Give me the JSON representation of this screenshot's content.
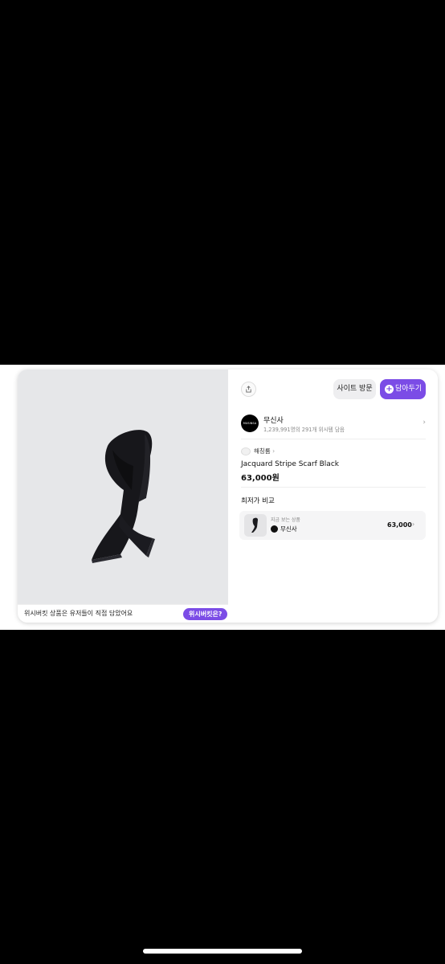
{
  "photo_footer": {
    "text": "위시버킷 상품은 유저들이 직접 담았어요",
    "pill_label": "위시버킷은?"
  },
  "header": {
    "visit_label": "사이트 방문",
    "save_label": "담아두기",
    "share_icon": "share-icon"
  },
  "store": {
    "logo_text": "MUSINSA",
    "name": "무신사",
    "meta": "1,239,991명의 291개 위시템 담음"
  },
  "product": {
    "brand": "해칭룸",
    "name": "Jacquard Stripe Scarf Black",
    "price": "63,000원"
  },
  "compare": {
    "title": "최저가 비교",
    "label": "지금 보는 상품",
    "store": "무신사",
    "price": "63,000"
  },
  "colors": {
    "accent": "#7b4ce6",
    "photo_bg": "#e6e7e9"
  }
}
